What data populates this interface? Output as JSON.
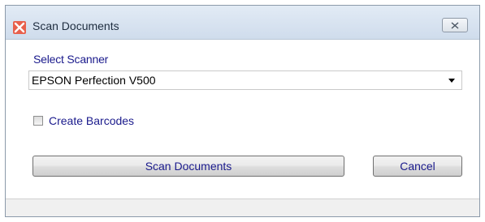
{
  "window": {
    "title": "Scan Documents",
    "app_icon": "scan-app-icon",
    "close_icon": "close-icon"
  },
  "form": {
    "select_label": "Select Scanner",
    "scanner": {
      "selected_value": "EPSON Perfection V500",
      "dropdown_icon": "chevron-down-icon"
    },
    "barcode_checkbox": {
      "label": "Create Barcodes",
      "checked": false
    }
  },
  "actions": {
    "scan_label": "Scan Documents",
    "cancel_label": "Cancel"
  },
  "colors": {
    "label_text": "#1a1a8c",
    "app_icon_bg": "#e8604c",
    "titlebar_bg": "#d8e4f1"
  }
}
